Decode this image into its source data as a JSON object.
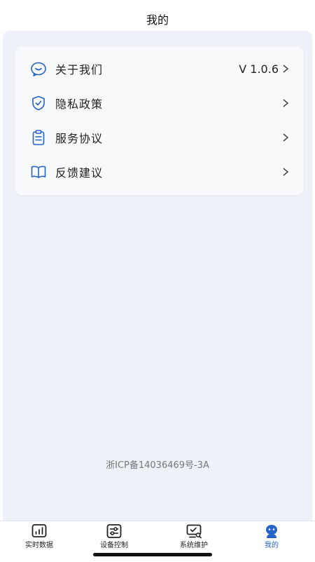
{
  "header": {
    "title": "我的"
  },
  "menu": {
    "items": [
      {
        "label": "关于我们",
        "value": "V 1.0.6",
        "icon": "smile-chat-icon"
      },
      {
        "label": "隐私政策",
        "value": "",
        "icon": "shield-check-icon"
      },
      {
        "label": "服务协议",
        "value": "",
        "icon": "clipboard-icon"
      },
      {
        "label": "反馈建议",
        "value": "",
        "icon": "book-icon"
      }
    ]
  },
  "footer": {
    "icp": "浙ICP备14036469号-3A"
  },
  "tabbar": {
    "tabs": [
      {
        "label": "实时数据",
        "icon": "chart-icon",
        "active": false
      },
      {
        "label": "设备控制",
        "icon": "sliders-icon",
        "active": false
      },
      {
        "label": "系统维护",
        "icon": "monitor-search-icon",
        "active": false
      },
      {
        "label": "我的",
        "icon": "user-icon",
        "active": true
      }
    ]
  },
  "colors": {
    "accent": "#2563c9",
    "background": "#eef1f7",
    "card": "#f8f9fb"
  }
}
